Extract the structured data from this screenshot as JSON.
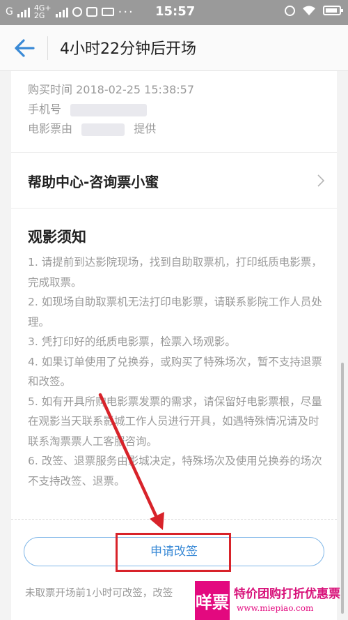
{
  "status_bar": {
    "carrier_left": "G",
    "net_top": "4G+",
    "net_bottom": "2G",
    "time": "15:57"
  },
  "header": {
    "title": "4小时22分钟后开场"
  },
  "order_info": {
    "purchase_time_label": "购买时间",
    "purchase_time": "2018-02-25 15:38:57",
    "phone_label": "手机号",
    "provider_prefix": "电影票由",
    "provider_suffix": "提供"
  },
  "help": {
    "label": "帮助中心-咨询票小蜜"
  },
  "notice": {
    "title": "观影须知",
    "items": [
      "1. 请提前到达影院现场，找到自助取票机，打印纸质电影票，完成取票。",
      "2. 如现场自助取票机无法打印电影票，请联系影院工作人员处理。",
      "3. 凭打印好的纸质电影票，检票入场观影。",
      "4. 如果订单使用了兑换券，或购买了特殊场次，暂不支持退票和改签。",
      "5. 如有开具所购电影票发票的需求，请保留好电影票根，尽量在观影当天联系影城工作人员进行开具，如遇特殊情况请及时联系淘票票人工客服咨询。",
      "6. 改签、退票服务由影城决定，特殊场次及使用兑换券的场次不支持改签、退票。"
    ]
  },
  "actions": {
    "apply_change_label": "申请改签"
  },
  "bottom_note": "未取票开场前1小时可改签，改签",
  "watermark": {
    "logo_char": "咩票",
    "text": "特价团购打折优惠票",
    "url": "www.miepiao.com"
  },
  "colors": {
    "accent": "#3a8ad6",
    "highlight": "#d8232a",
    "watermark": "#e3097f"
  }
}
